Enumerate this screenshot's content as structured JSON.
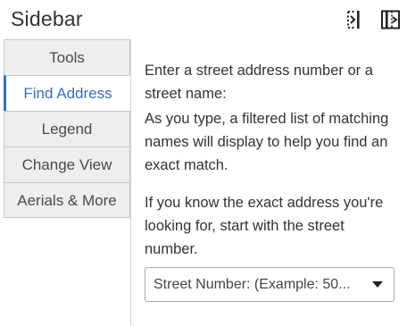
{
  "sidebar": {
    "title": "Sidebar",
    "tabs": [
      {
        "label": "Tools",
        "active": false
      },
      {
        "label": "Find Address",
        "active": true
      },
      {
        "label": "Legend",
        "active": false
      },
      {
        "label": "Change View",
        "active": false
      },
      {
        "label": "Aerials & More",
        "active": false
      }
    ]
  },
  "find_address": {
    "instruction": "Enter a street address number or a street name:",
    "filter_help": "As you type, a filtered list of matching names will display to help you find an exact match.",
    "exact_help": "If you know the exact address you're looking for, start with the street number.",
    "street_number_select": "Street Number: (Example: 50..."
  },
  "icons": {
    "collapse": "collapse-panel-icon",
    "dock": "dock-panel-icon",
    "caret": "chevron-down-icon"
  },
  "colors": {
    "accent": "#3a6fb5",
    "tab_background": "#eeeeee",
    "text": "#333333"
  }
}
